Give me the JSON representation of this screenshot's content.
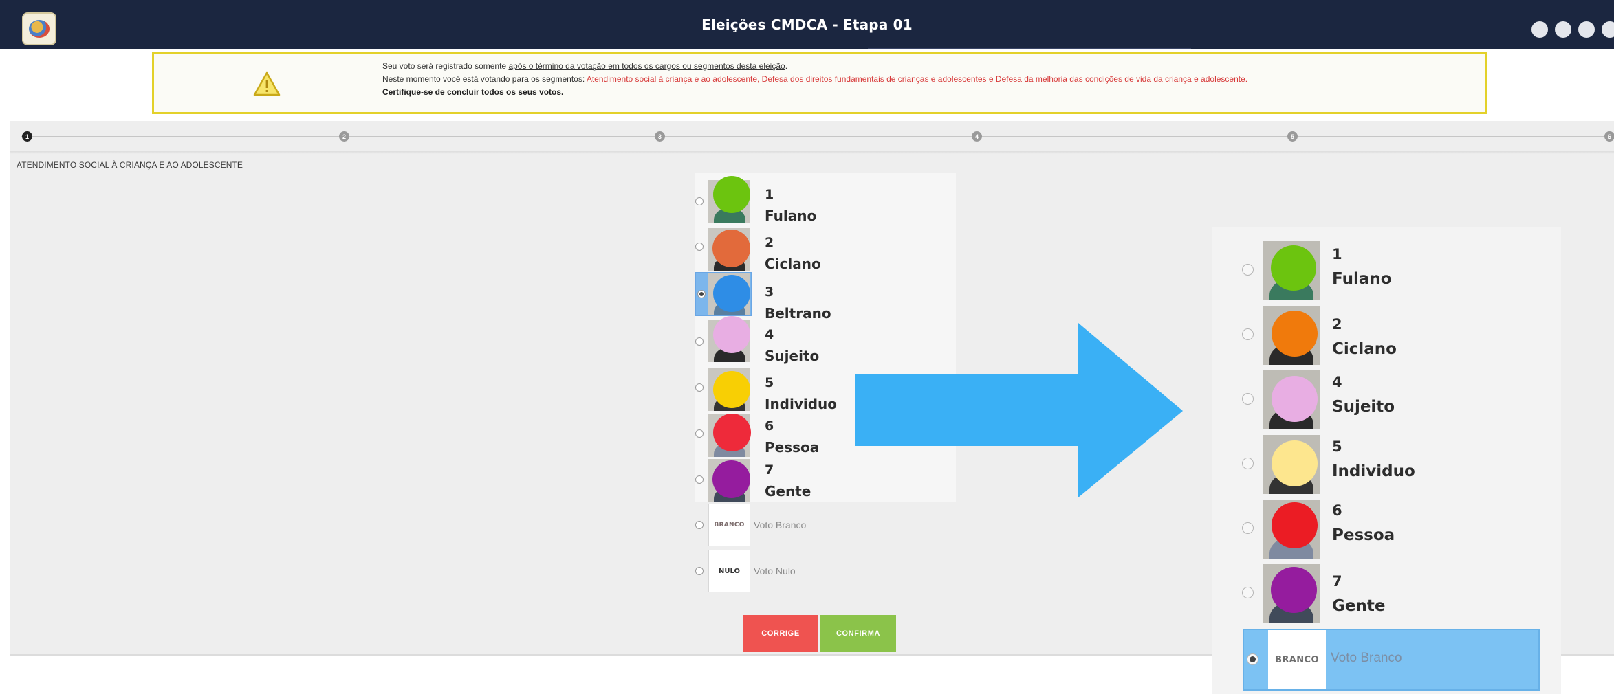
{
  "header": {
    "title": "Eleições CMDCA - Etapa 01",
    "logo_text": "CMDCA",
    "controls": [
      "",
      "",
      "",
      ""
    ]
  },
  "notice": {
    "line1_before": "Seu voto será registrado somente ",
    "line1_underlined": "após o término da votação em todos os cargos ou segmentos desta eleição",
    "line1_after": ".",
    "line2_before": "Neste momento você está votando para os segmentos: ",
    "line2_segments": "Atendimento social à criança e ao adolescente, Defesa dos direitos fundamentais de crianças e adolescentes e Defesa da melhoria das condições de vida da criança e adolescente.",
    "line3": "Certifique-se de concluir todos os seus votos."
  },
  "stepper": {
    "steps": [
      "1",
      "2",
      "3",
      "4",
      "5",
      "6"
    ],
    "active_index": 0
  },
  "segment_title": "ATENDIMENTO SOCIAL À CRIANÇA E AO ADOLESCENTE",
  "candidates": [
    {
      "number": "1",
      "name": "Fulano",
      "face_color": "#6cc40f",
      "selected": false
    },
    {
      "number": "2",
      "name": "Ciclano",
      "face_color": "#e26a3b",
      "selected": false
    },
    {
      "number": "3",
      "name": "Beltrano",
      "face_color": "#2e8de6",
      "selected": true
    },
    {
      "number": "4",
      "name": "Sujeito",
      "face_color": "#e8aee3",
      "selected": false
    },
    {
      "number": "5",
      "name": "Individuo",
      "face_color": "#f8cf04",
      "selected": false
    },
    {
      "number": "6",
      "name": "Pessoa",
      "face_color": "#ee2a3a",
      "selected": false
    },
    {
      "number": "7",
      "name": "Gente",
      "face_color": "#951c9e",
      "selected": false
    }
  ],
  "special_votes": {
    "blank": {
      "box": "BRANCO",
      "label": "Voto Branco"
    },
    "null": {
      "box": "NULO",
      "label": "Voto Nulo"
    }
  },
  "buttons": {
    "corrige": "CORRIGE",
    "confirma": "CONFIRMA"
  },
  "zoom": {
    "candidates": [
      {
        "number": "1",
        "name": "Fulano",
        "face_color": "#6cc40f"
      },
      {
        "number": "2",
        "name": "Ciclano",
        "face_color": "#f07a0c"
      },
      {
        "number": "4",
        "name": "Sujeito",
        "face_color": "#e8aee3"
      },
      {
        "number": "5",
        "name": "Individuo",
        "face_color": "#fde68e"
      },
      {
        "number": "6",
        "name": "Pessoa",
        "face_color": "#eb1c24"
      },
      {
        "number": "7",
        "name": "Gente",
        "face_color": "#951c9e"
      }
    ],
    "selected_vote": {
      "box": "BRANCO",
      "label": "Voto Branco"
    }
  },
  "colors": {
    "header_bg": "#1b2640",
    "notice_border": "#e3d12a",
    "segment_red": "#d73a3a",
    "arrow": "#3ab0f5",
    "corrige": "#ef5350",
    "confirma": "#8bc34a",
    "selection": "#7cc2f3"
  },
  "icons": {
    "warning": "warning-triangle-icon",
    "radio": "radio-icon"
  }
}
